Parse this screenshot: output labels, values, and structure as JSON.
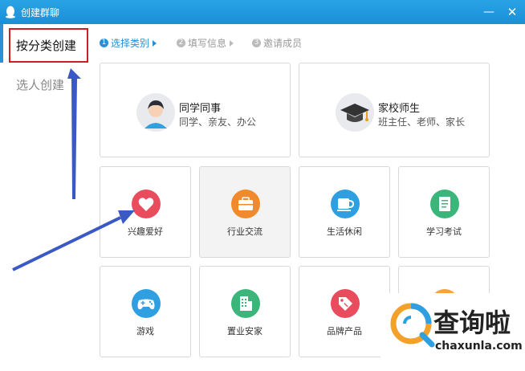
{
  "window": {
    "title": "创建群聊",
    "minimize_glyph": "—",
    "close_glyph": "✕"
  },
  "sidebar": {
    "items": [
      {
        "label": "按分类创建",
        "active": true
      },
      {
        "label": "选人创建",
        "active": false
      }
    ]
  },
  "steps": [
    {
      "num": "1",
      "label": "选择类别"
    },
    {
      "num": "2",
      "label": "填写信息"
    },
    {
      "num": "3",
      "label": "邀请成员"
    }
  ],
  "big_cards": [
    {
      "title": "同学同事",
      "subtitle": "同学、亲友、办公",
      "icon": "person-avatar-icon"
    },
    {
      "title": "家校师生",
      "subtitle": "班主任、老师、家长",
      "icon": "graduation-cap-icon"
    }
  ],
  "categories": [
    {
      "label": "兴趣爱好",
      "icon": "heart-icon",
      "color": "#e94c5c"
    },
    {
      "label": "行业交流",
      "icon": "briefcase-icon",
      "color": "#f08a2c"
    },
    {
      "label": "生活休闲",
      "icon": "cup-icon",
      "color": "#2e9fe0"
    },
    {
      "label": "学习考试",
      "icon": "book-icon",
      "color": "#3cb57a"
    },
    {
      "label": "游戏",
      "icon": "gamepad-icon",
      "color": "#2e9fe0"
    },
    {
      "label": "置业安家",
      "icon": "building-icon",
      "color": "#3cb57a"
    },
    {
      "label": "品牌产品",
      "icon": "tag-icon",
      "color": "#e94c5c"
    },
    {
      "label": "",
      "icon": "star-icon",
      "color": "#f5a33a"
    }
  ],
  "watermark": {
    "name": "查询啦",
    "url": "chaxunla.com"
  },
  "colors": {
    "titlebar": "#1a8fd6",
    "accent": "#2a8fd6",
    "highlight_box": "#cc2020",
    "annotation_arrow": "#3a59c4"
  }
}
